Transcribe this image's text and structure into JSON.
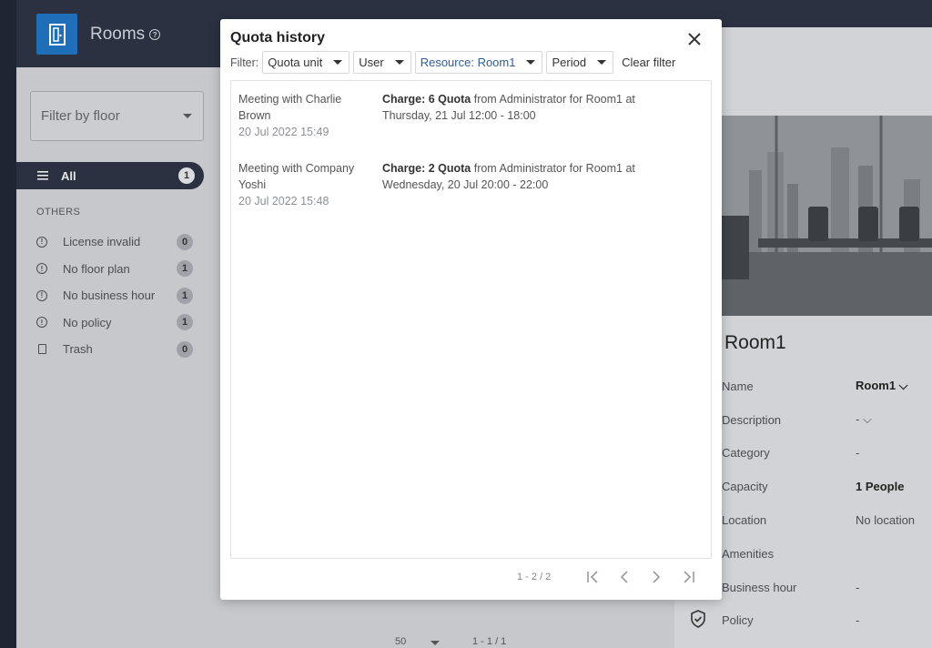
{
  "app": {
    "title": "Rooms"
  },
  "sidebar": {
    "floor_filter_placeholder": "Filter by floor",
    "all_item": {
      "label": "All",
      "count": "1"
    },
    "section_title": "OTHERS",
    "items": [
      {
        "icon": "alert-circle-icon",
        "label": "License invalid",
        "count": "0"
      },
      {
        "icon": "alert-circle-icon",
        "label": "No floor plan",
        "count": "1"
      },
      {
        "icon": "alert-circle-icon",
        "label": "No business hour",
        "count": "1"
      },
      {
        "icon": "alert-circle-icon",
        "label": "No policy",
        "count": "1"
      },
      {
        "icon": "trash-icon",
        "label": "Trash",
        "count": "0"
      }
    ]
  },
  "center": {
    "page_size": "50",
    "pager_range": "1 - 1 / 1"
  },
  "room_panel": {
    "title": "Room1",
    "properties": [
      {
        "key": "Name",
        "value": "Room1 ⌵",
        "bold": true
      },
      {
        "key": "Description",
        "value": "- ⌵",
        "bold": false
      },
      {
        "key": "Category",
        "value": "-",
        "bold": false
      },
      {
        "key": "Capacity",
        "value": "1 People",
        "bold": true
      },
      {
        "key": "Location",
        "value": "No location",
        "bold": false
      },
      {
        "key": "Amenities",
        "value": "",
        "bold": false
      },
      {
        "key": "Business hour",
        "value": "-",
        "bold": false
      },
      {
        "key": "Policy",
        "value": "-",
        "bold": false
      }
    ]
  },
  "modal": {
    "title": "Quota history",
    "filter_label": "Filter:",
    "filters": {
      "quota_unit": "Quota unit",
      "user": "User",
      "resource": "Resource: Room1",
      "period": "Period"
    },
    "clear_filter": "Clear filter",
    "entries": [
      {
        "title_line1": "Meeting with Charlie",
        "title_line2": "Brown",
        "timestamp": "20 Jul 2022 15:49",
        "charge": "Charge: 6 Quota",
        "detail_line1": " from Administrator for Room1 at",
        "detail_line2": "Thursday, 21 Jul 12:00 - 18:00"
      },
      {
        "title_line1": "Meeting with Company",
        "title_line2": "Yoshi",
        "timestamp": "20 Jul 2022 15:48",
        "charge": "Charge: 2 Quota",
        "detail_line1": " from Administrator for Room1 at",
        "detail_line2": "Wednesday, 20 Jul 20:00 - 22:00"
      }
    ],
    "pager_range": "1 - 2 / 2"
  },
  "colors": {
    "brand": "#1e6fb8",
    "topbar": "#2b3140",
    "active_filter": "#2f5d9b"
  }
}
